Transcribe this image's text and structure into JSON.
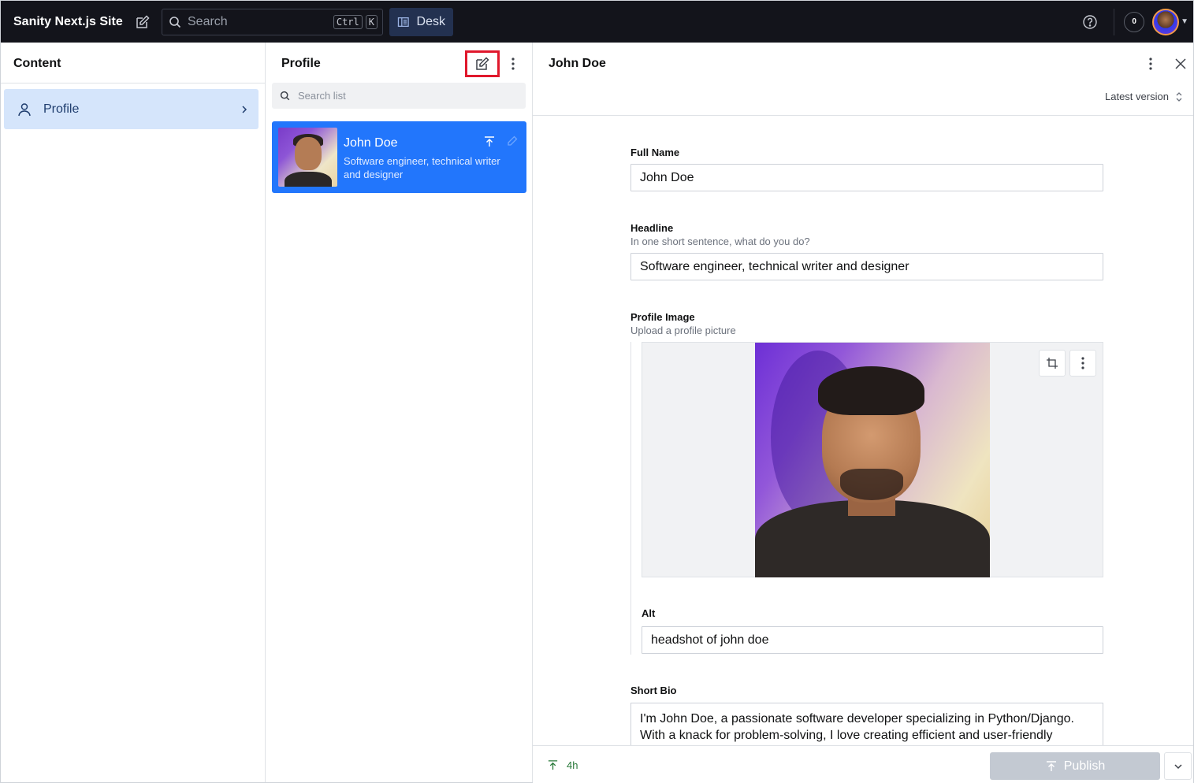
{
  "topbar": {
    "brand": "Sanity Next.js Site",
    "search_placeholder": "Search",
    "search_kbd_1": "Ctrl",
    "search_kbd_2": "K",
    "desk_label": "Desk",
    "presence_count": "0"
  },
  "content_pane": {
    "title": "Content",
    "items": [
      {
        "label": "Profile"
      }
    ]
  },
  "list_pane": {
    "title": "Profile",
    "search_placeholder": "Search list",
    "items": [
      {
        "title": "John Doe",
        "subtitle": "Software engineer, technical writer and designer"
      }
    ]
  },
  "document": {
    "title": "John Doe",
    "version_label": "Latest version",
    "fields": {
      "full_name": {
        "label": "Full Name",
        "value": "John Doe"
      },
      "headline": {
        "label": "Headline",
        "description": "In one short sentence, what do you do?",
        "value": "Software engineer, technical writer and designer"
      },
      "profile_image": {
        "label": "Profile Image",
        "description": "Upload a profile picture"
      },
      "alt": {
        "label": "Alt",
        "value": "headshot of john doe"
      },
      "short_bio": {
        "label": "Short Bio",
        "value": "I'm John Doe, a passionate software developer specializing in Python/Django. With a knack for problem-solving, I love creating efficient and user-friendly"
      }
    },
    "footer": {
      "status_time": "4h",
      "publish_label": "Publish"
    }
  },
  "colors": {
    "topbar_bg": "#13141b",
    "selected_item": "#2276fc",
    "nav_selected": "#d5e5fb",
    "highlight_border": "#e0182c"
  }
}
